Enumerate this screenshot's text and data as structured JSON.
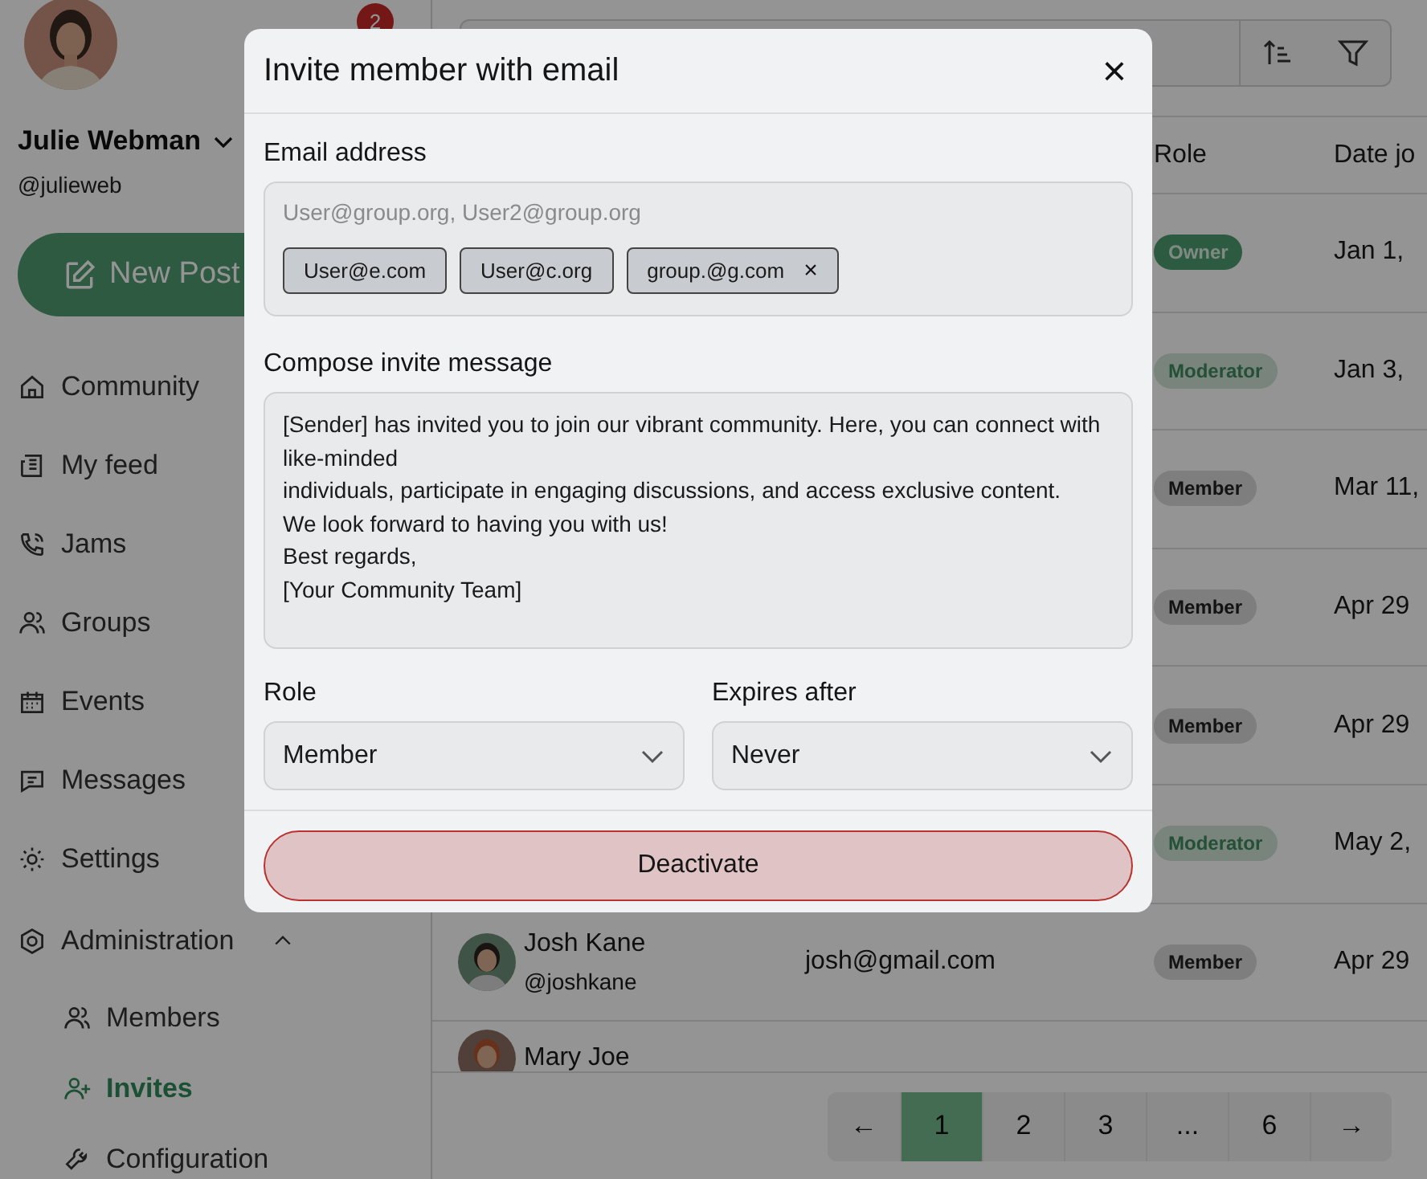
{
  "sidebar": {
    "notification_count": "2",
    "user": {
      "name": "Julie Webman",
      "handle": "@julieweb"
    },
    "new_post_button": "New Post",
    "items": [
      {
        "label": "Community",
        "selected": false
      },
      {
        "label": "My feed",
        "selected": false
      },
      {
        "label": "Jams",
        "selected": false
      },
      {
        "label": "Groups",
        "selected": false
      },
      {
        "label": "Events",
        "selected": false
      },
      {
        "label": "Messages",
        "selected": false
      },
      {
        "label": "Settings",
        "selected": false
      },
      {
        "label": "Administration",
        "selected": false,
        "expanded": true,
        "children": [
          {
            "label": "Members",
            "selected": false
          },
          {
            "label": "Invites",
            "selected": true
          },
          {
            "label": "Configuration",
            "selected": false
          }
        ]
      }
    ]
  },
  "table": {
    "columns": [
      "Role",
      "Date jo"
    ],
    "rows": [
      {
        "role": "Owner",
        "kind": "owner",
        "date": "Jan 1,"
      },
      {
        "role": "Moderator",
        "kind": "moderator",
        "date": "Jan 3,"
      },
      {
        "role": "Member",
        "kind": "member",
        "date": "Mar 11,"
      },
      {
        "role": "Member",
        "kind": "member",
        "date": "Apr 29"
      },
      {
        "role": "Member",
        "kind": "member",
        "date": "Apr 29"
      },
      {
        "role": "Moderator",
        "kind": "moderator",
        "date": "May 2,"
      },
      {
        "name": "Josh Kane",
        "handle": "@joshkane",
        "email": "josh@gmail.com",
        "role": "Member",
        "kind": "member",
        "date": "Apr 29"
      },
      {
        "name": "Mary Joe"
      }
    ]
  },
  "pagination": {
    "prev": "←",
    "next": "→",
    "pages": [
      {
        "label": "1",
        "selected": true
      },
      {
        "label": "2",
        "selected": false
      },
      {
        "label": "3",
        "selected": false
      },
      {
        "label": "...",
        "selected": false
      },
      {
        "label": "6",
        "selected": false
      }
    ]
  },
  "dialog": {
    "title": "Invite member with email",
    "close": "×",
    "email_label": "Email address",
    "email_placeholder": "User@group.org, User2@group.org",
    "chips": [
      {
        "label": "User@e.com",
        "removable": false
      },
      {
        "label": "User@c.org",
        "removable": false
      },
      {
        "label": "group.@g.com",
        "removable": true,
        "remove": "×"
      }
    ],
    "message_label": "Compose invite message",
    "message": "[Sender] has invited you to join our vibrant community. Here, you can connect with like-minded\nindividuals, participate in engaging discussions, and access exclusive content.\nWe look forward to having you with us!\nBest regards,\n[Your Community Team]",
    "role_label": "Role",
    "role_value": "Member",
    "expires_label": "Expires after",
    "expires_value": "Never",
    "button": "Deactivate"
  }
}
